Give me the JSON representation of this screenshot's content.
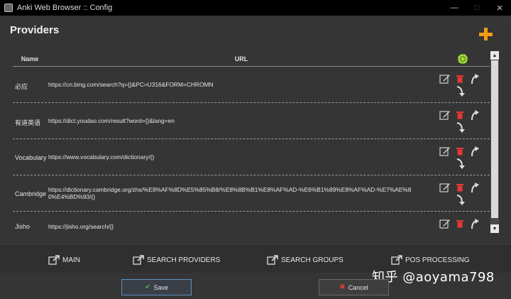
{
  "window": {
    "title": "Anki Web Browser :: Config",
    "controls": {
      "minimize": "—",
      "maximize": "□",
      "close": "✕"
    }
  },
  "page": {
    "heading": "Providers"
  },
  "table": {
    "headers": {
      "name": "Name",
      "url": "URL"
    },
    "rows": [
      {
        "name": "必应",
        "url": "https://cn.bing.com/search?q={}&PC=U316&FORM=CHROMN"
      },
      {
        "name": "有道英语",
        "url": "https://dict.youdao.com/result?word={}&lang=en"
      },
      {
        "name": "Vocabulary",
        "url": "https://www.vocabulary.com/dictionary/{}"
      },
      {
        "name": "Cambridge",
        "url": "https://dictionary.cambridge.org/zhs/%E8%AF%8D%E5%85%B8/%E8%8B%B1%E8%AF%AD-%E6%B1%89%E8%AF%AD-%E7%AE%80%E4%BD%93/{}"
      },
      {
        "name": "Jisho",
        "url": "https://jisho.org/search/{}"
      }
    ]
  },
  "nav": {
    "items": [
      "MAIN",
      "SEARCH PROVIDERS",
      "SEARCH GROUPS",
      "POS PROCESSING"
    ]
  },
  "watermark": "知乎 @aoyama798",
  "buttons": {
    "save": "Save",
    "cancel": "Cancel"
  },
  "colors": {
    "accent_add": "#f39c12",
    "delete": "#e53935",
    "check": "#4caf50"
  },
  "icons": {
    "add": "plus-icon",
    "settings": "gear-icon",
    "edit": "edit-icon",
    "delete": "trash-icon",
    "up": "arrow-up-icon",
    "down": "arrow-down-icon",
    "external": "external-link-icon"
  }
}
